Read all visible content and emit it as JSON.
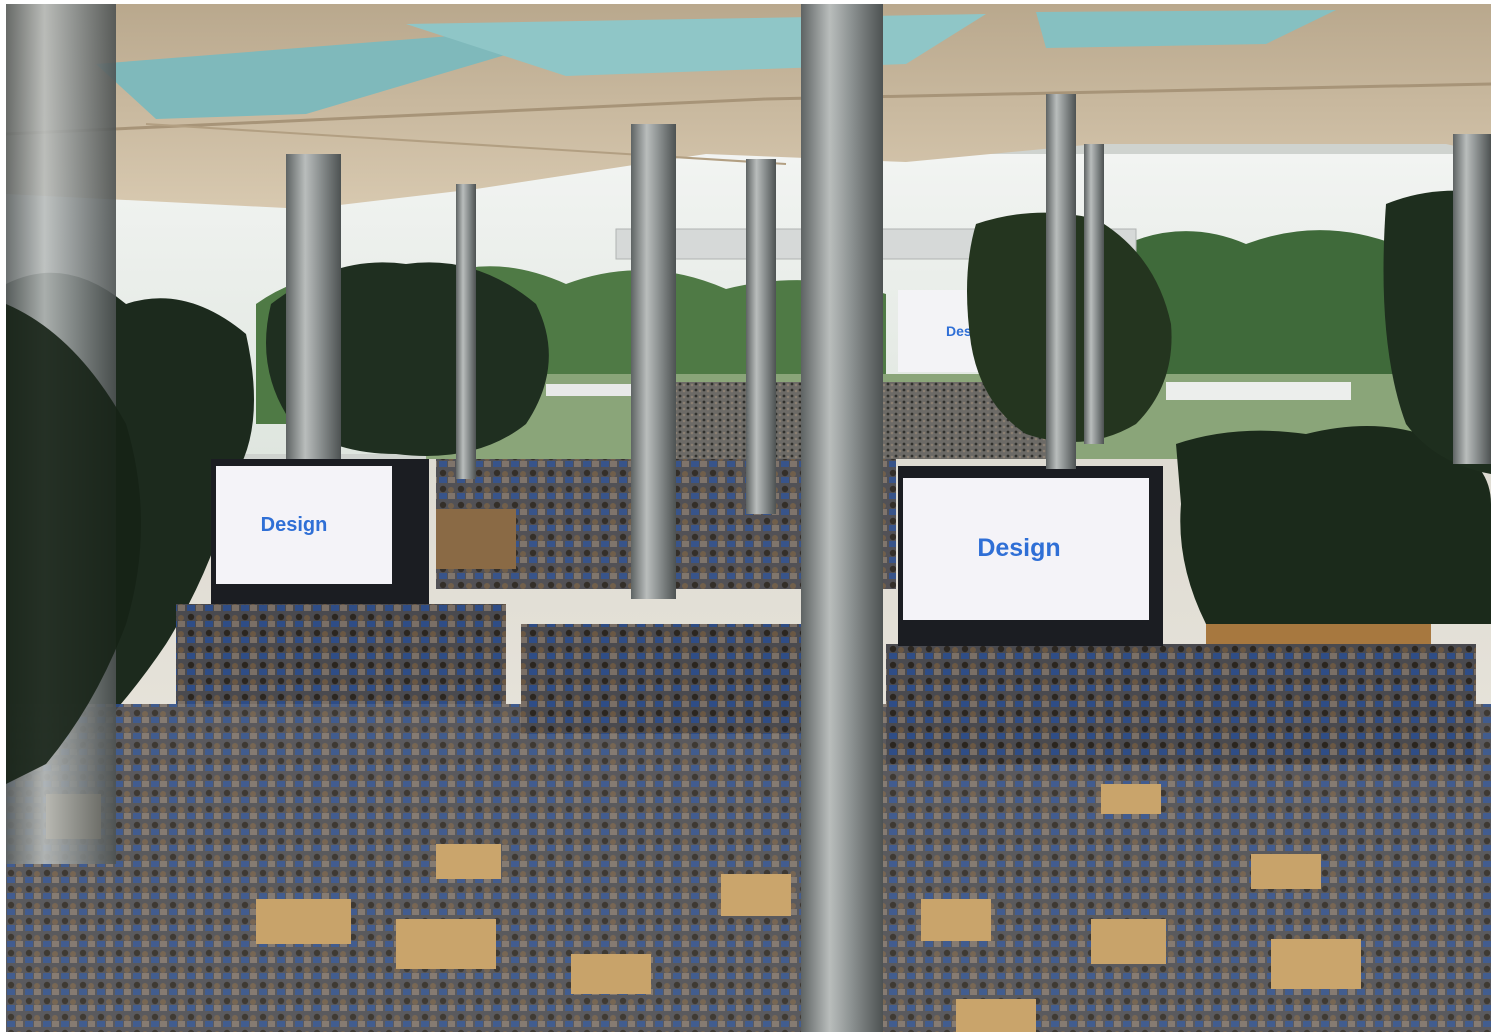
{
  "photo": {
    "subject": "keynote-audience-atrium",
    "screens": {
      "left": {
        "label": "Design"
      },
      "center": {
        "label": "Design"
      },
      "far": {
        "label": "Desi"
      }
    },
    "colors": {
      "ceiling": "#c9b79c",
      "skylight": "#7fb9bb",
      "floor": "#e9e4da",
      "foliage": "#1c2a1d",
      "screen": "#f4f3f8",
      "screen_text": "#2f6fd6",
      "column": "#9da2a2"
    }
  }
}
